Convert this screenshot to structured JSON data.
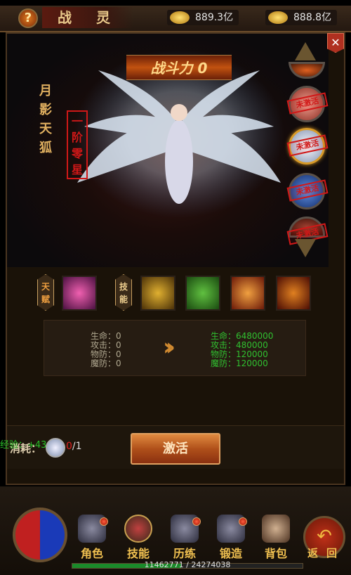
{
  "header": {
    "title": "战 灵",
    "help_icon": "?",
    "gold": "889.3亿",
    "ingot": "888.8亿"
  },
  "spirit": {
    "name": "月影天狐",
    "rank": "一阶零星",
    "power": "战斗力 0"
  },
  "spirit_list": [
    {
      "stamp": "未激活",
      "selected": false
    },
    {
      "stamp": "未激活",
      "selected": true
    },
    {
      "stamp": "未激活",
      "selected": false
    },
    {
      "stamp": "未激活",
      "selected": false
    }
  ],
  "skills": {
    "talent_label": "天赋",
    "skill_label": "技能"
  },
  "stats": {
    "current": [
      "生命：0",
      "攻击：0",
      "物防：0",
      "魔防：0"
    ],
    "next": [
      "生命：6480000",
      "攻击：480000",
      "物防：120000",
      "魔防：120000"
    ]
  },
  "cost": {
    "exp_text": "经验：+43",
    "label": "消耗：",
    "have": "0",
    "need": "/1"
  },
  "activate_label": "激活",
  "close_icon": "✕",
  "nav": {
    "items": [
      "角色",
      "技能",
      "历练",
      "锻造",
      "背包"
    ],
    "selected": 1,
    "back_label": "返回",
    "xp_text": "11462771 / 24274038",
    "xp_fraction": 0.472
  },
  "colors": {
    "accent": "#f0c050",
    "stat_new": "#30c030",
    "stamp": "#d01818"
  }
}
